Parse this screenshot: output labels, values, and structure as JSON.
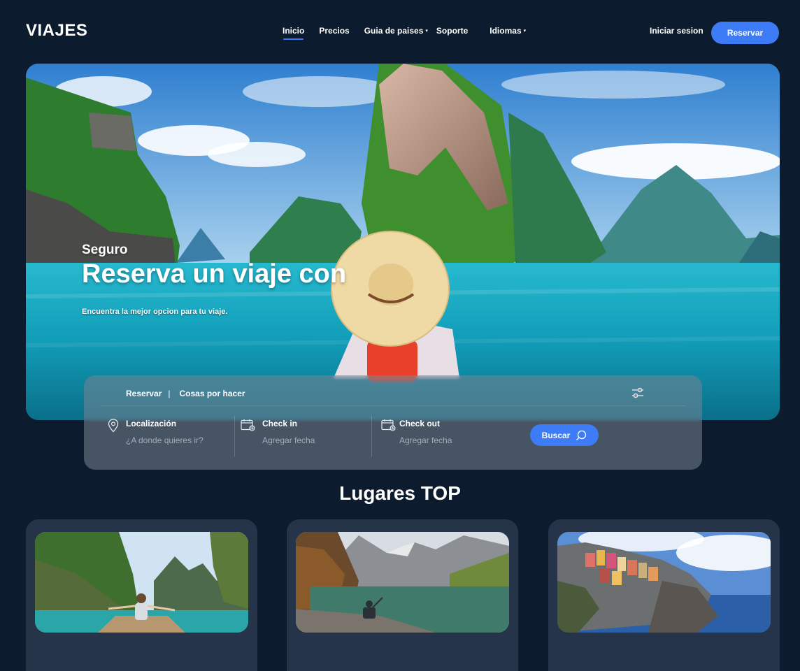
{
  "header": {
    "logo": "VIAJES",
    "nav": [
      {
        "label": "Inicio",
        "active": true
      },
      {
        "label": "Precios"
      },
      {
        "label": "Guia de paises",
        "caret": "▾"
      },
      {
        "label": "Soporte"
      },
      {
        "label": "Idiomas",
        "caret": "▾"
      }
    ],
    "login": "Iniciar sesion",
    "cta": "Reservar"
  },
  "hero": {
    "subtitle": "Seguro",
    "title": "Reserva un viaje con",
    "description": "Encuentra la mejor opcion para tu viaje."
  },
  "search": {
    "tabs": [
      "Reservar",
      "Cosas por hacer"
    ],
    "separator": "|",
    "fields": [
      {
        "label": "Localización",
        "placeholder": "¿A donde quieres ir?",
        "icon": "location-pin-icon"
      },
      {
        "label": "Check in",
        "placeholder": "Agregar fecha",
        "icon": "calendar-icon"
      },
      {
        "label": "Check out",
        "placeholder": "Agregar fecha",
        "icon": "calendar-icon"
      }
    ],
    "button": "Buscar"
  },
  "section": {
    "title": "Lugares TOP"
  },
  "colors": {
    "background": "#0d1b2e",
    "accent": "#3d7bf7",
    "card": "#26344a"
  }
}
